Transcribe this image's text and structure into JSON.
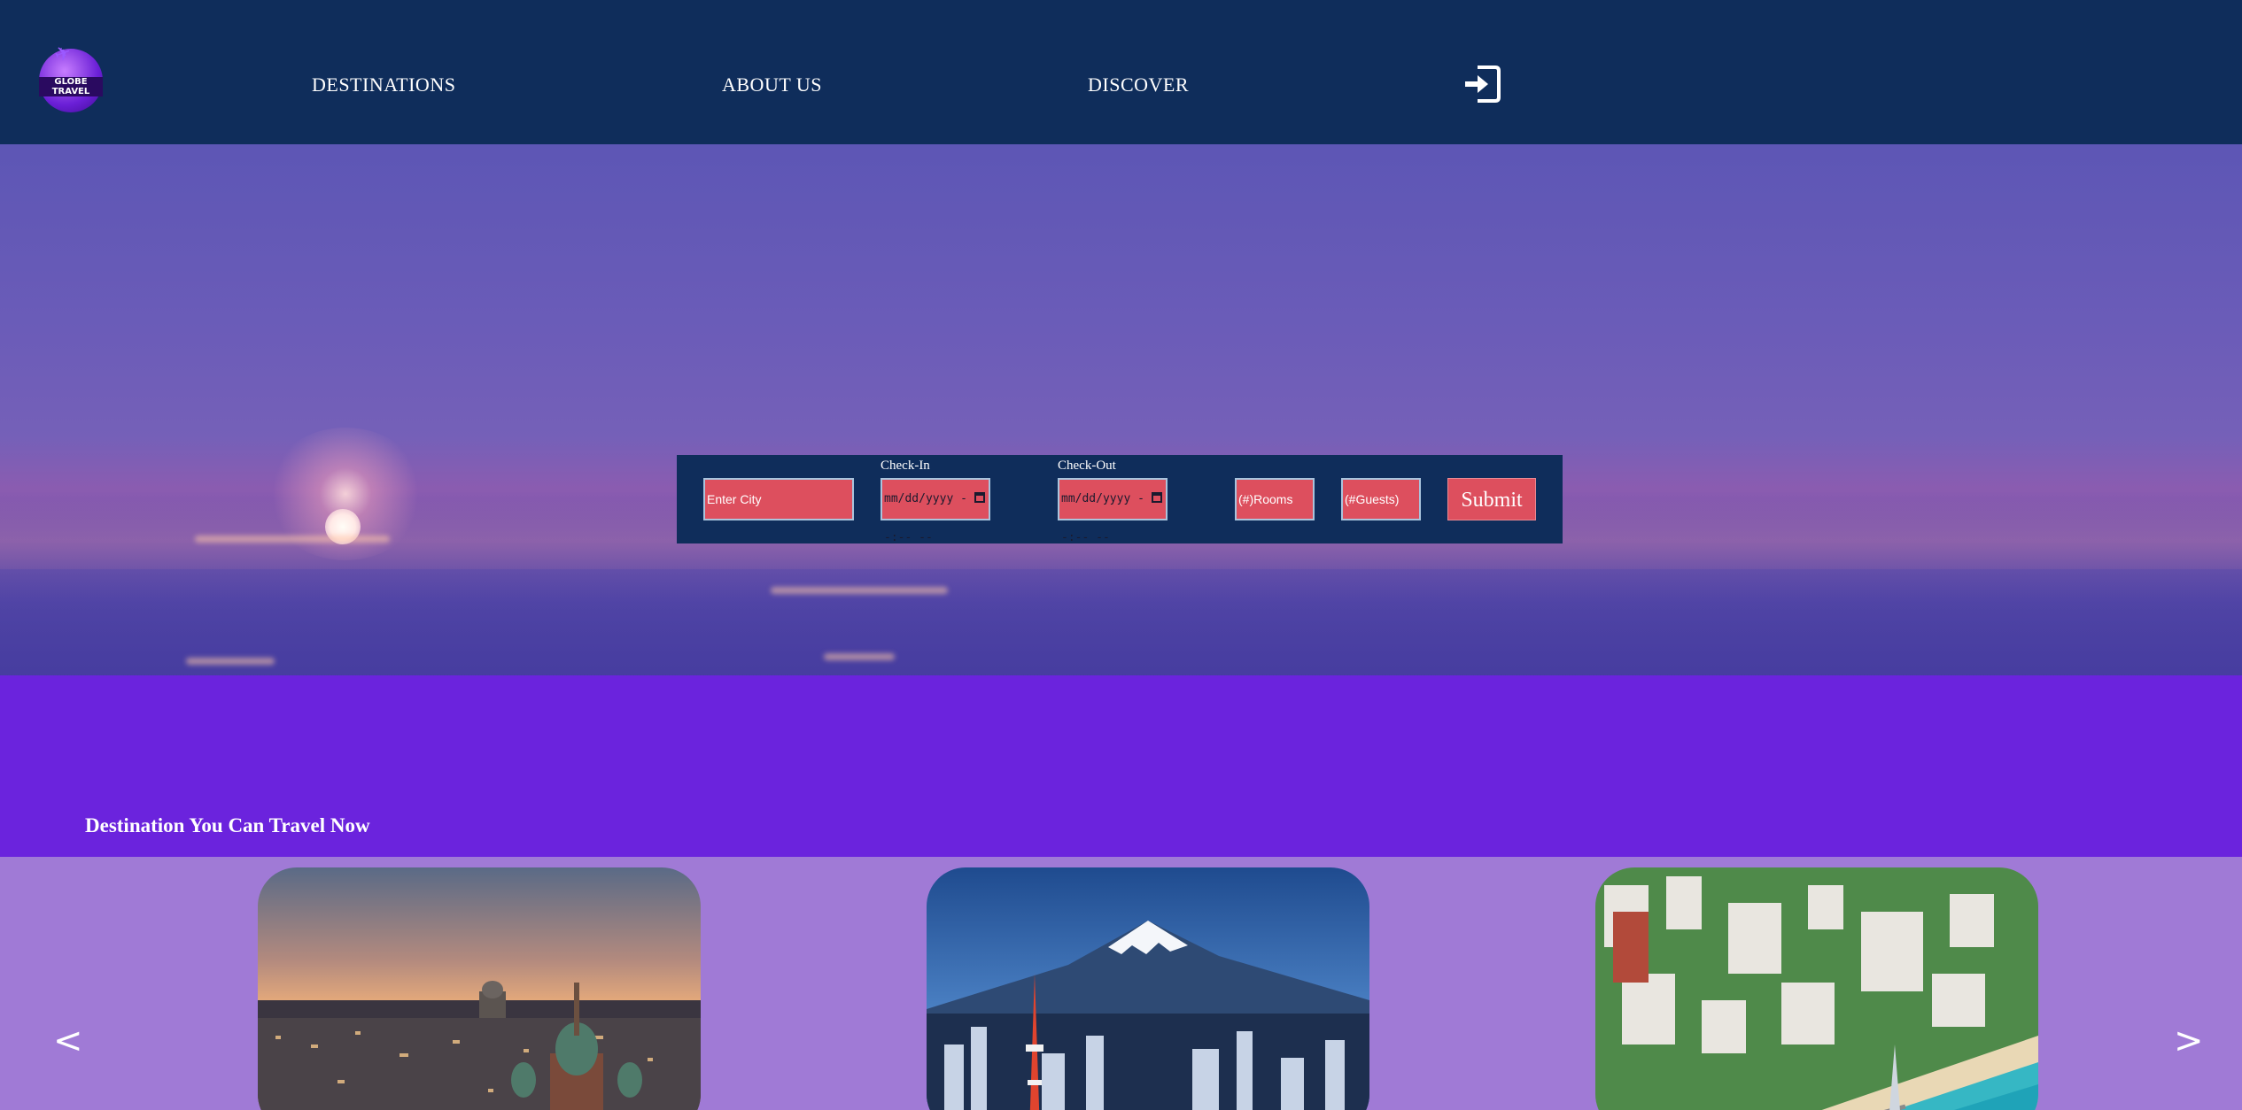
{
  "header": {
    "logo_text": "GLOBE TRAVEL",
    "nav": [
      "DESTINATIONS",
      "ABOUT US",
      "DISCOVER"
    ],
    "login_icon": "sign-in-icon"
  },
  "search": {
    "city_placeholder": "Enter City",
    "checkin_label": "Check-In",
    "checkin_value": "mm/dd/yyyy --:-- --",
    "checkout_label": "Check-Out",
    "checkout_value": "mm/dd/yyyy --:-- --",
    "rooms_placeholder": "(#)Rooms",
    "guests_placeholder": "(#Guests)",
    "submit_label": "Submit"
  },
  "section": {
    "title": "Destination You Can Travel Now"
  },
  "carousel": {
    "prev_label": "<",
    "next_label": ">",
    "cards": [
      {
        "scene": "sunset-city-with-cathedral"
      },
      {
        "scene": "mount-fuji-with-tokyo-tower"
      },
      {
        "scene": "beach-resort-town"
      }
    ]
  },
  "colors": {
    "header_bg": "#0f2d5b",
    "accent_red": "#dd4f5e",
    "band_purple": "#6b23dd",
    "carousel_bg": "#a07ad6"
  }
}
